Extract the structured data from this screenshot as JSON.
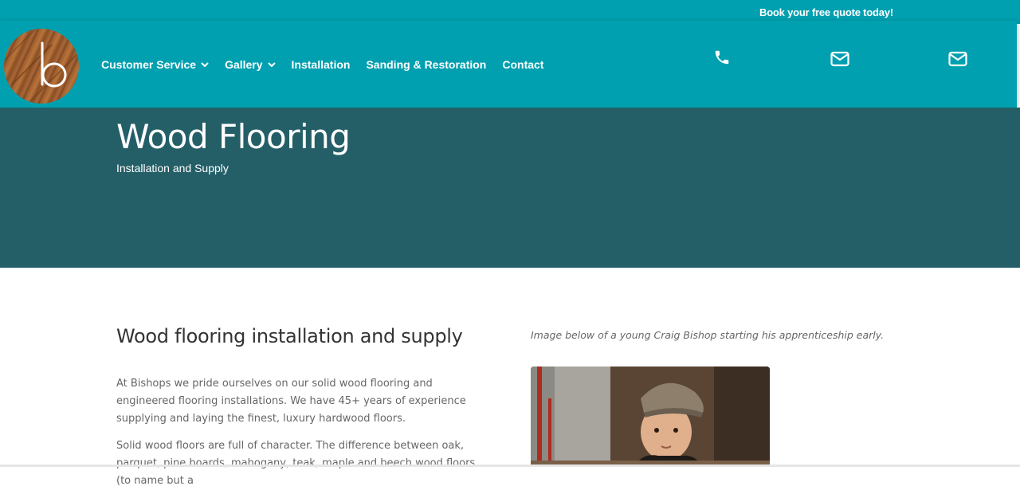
{
  "topbar": {
    "quote": "Book your free quote today!"
  },
  "logo": {
    "letter": "b"
  },
  "nav": [
    {
      "label": "Customer Service",
      "dropdown": true
    },
    {
      "label": "Gallery",
      "dropdown": true
    },
    {
      "label": "Installation",
      "dropdown": false
    },
    {
      "label": "Sanding & Restoration",
      "dropdown": false
    },
    {
      "label": "Contact",
      "dropdown": false
    }
  ],
  "header_icons": [
    "phone-icon",
    "mail-icon",
    "mail-icon"
  ],
  "hero": {
    "title": "Wood Flooring",
    "subtitle": "Installation and Supply"
  },
  "content": {
    "heading": "Wood flooring installation and supply",
    "paragraph1": "At Bishops we pride ourselves on our solid wood flooring and engineered flooring installations. We have 45+ years of experience supplying and laying the finest, luxury hardwood floors.",
    "paragraph2": "Solid wood floors are full of character. The difference between oak, parquet, pine boards, mahogany, teak, maple and beech wood floors (to name but a",
    "caption": "Image below of a young Craig Bishop starting his apprenticeship early."
  },
  "colors": {
    "header": "#00a0b0",
    "hero": "#245f68",
    "text": "#666666"
  }
}
